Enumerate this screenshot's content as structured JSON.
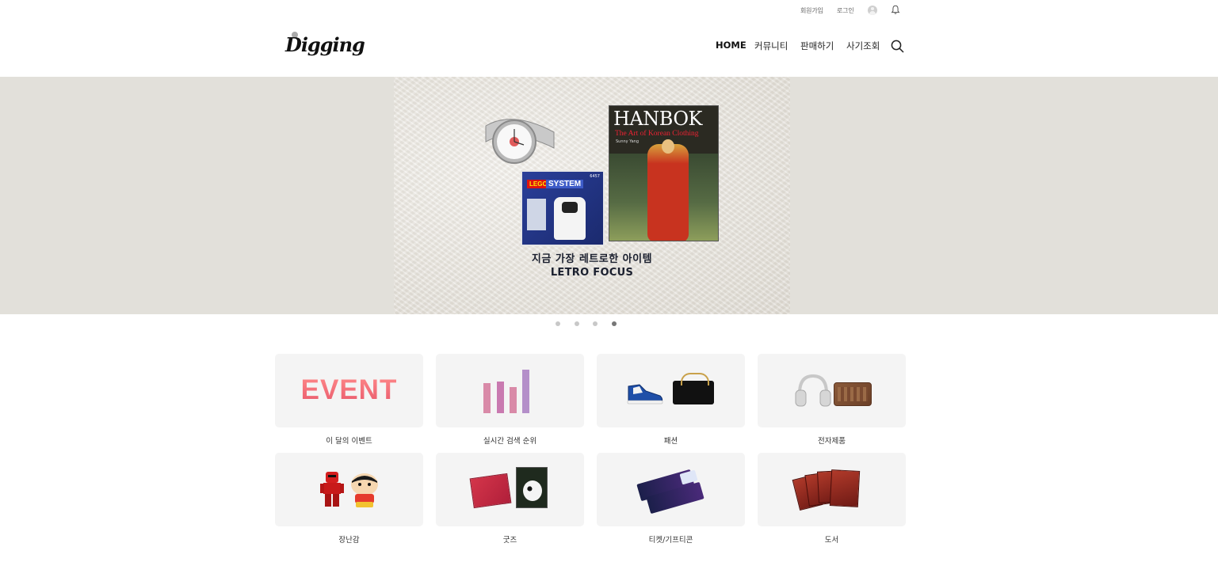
{
  "utility": {
    "signup": "회원가입",
    "login": "로그인",
    "profile_icon": "user-avatar-icon",
    "notification_icon": "bell-icon"
  },
  "header": {
    "logo": "Digging",
    "nav": {
      "home": "HOME",
      "community": "커뮤니티",
      "sell": "판매하기",
      "fraud_check": "사기조회"
    },
    "search_icon": "search-icon"
  },
  "banner": {
    "book_title": "HANBOK",
    "book_subtitle": "The Art of Korean Clothing",
    "book_author": "Sunny Yang",
    "lego_brand": "LEGO",
    "lego_line": "SYSTEM",
    "lego_number": "6457",
    "caption_kr": "지금 가장 레트로한 아이템",
    "caption_en": "LETRO FOCUS",
    "background_color": "#e2e0da",
    "slides": 4,
    "active_slide": 4
  },
  "categories": [
    {
      "label": "이 달의 이벤트",
      "tile_text": "EVENT"
    },
    {
      "label": "실시간 검색 순위"
    },
    {
      "label": "패션"
    },
    {
      "label": "전자제품"
    },
    {
      "label": "장난감"
    },
    {
      "label": "굿즈"
    },
    {
      "label": "티켓/기프티콘"
    },
    {
      "label": "도서"
    }
  ],
  "colors": {
    "tile_bg": "#f4f4f4",
    "dot_inactive": "#c8c8c8",
    "dot_active": "#777777",
    "event_gradient": [
      "#ff8a8a",
      "#e8586b"
    ]
  }
}
